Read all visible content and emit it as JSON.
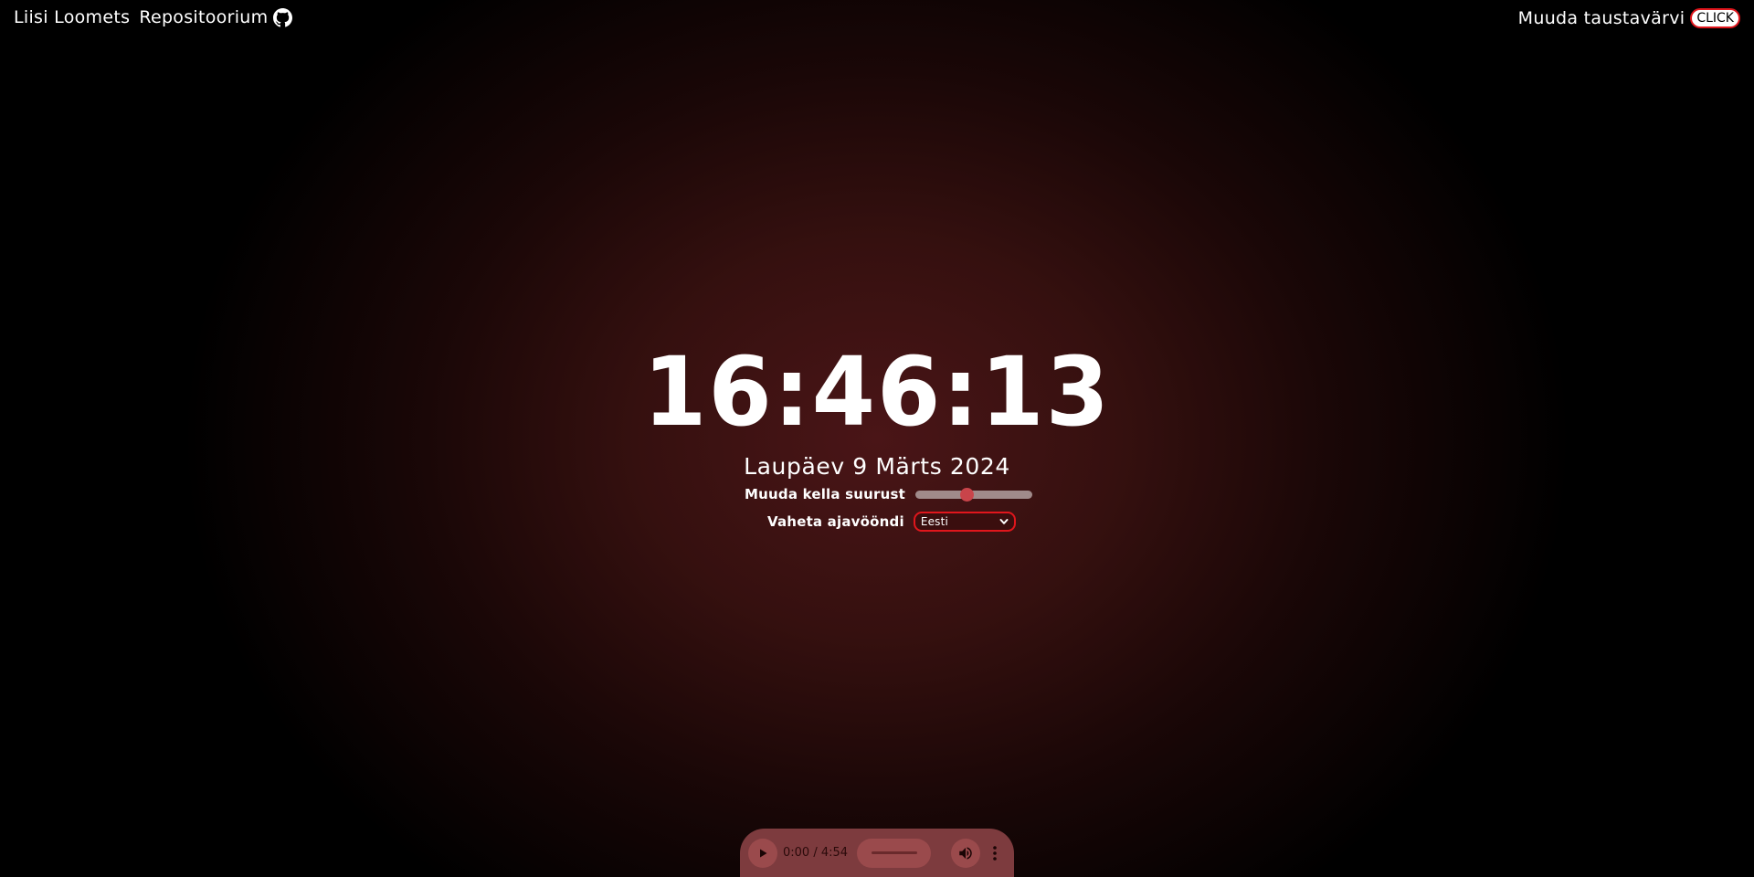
{
  "header": {
    "author": "Liisi Loomets",
    "repo_label": "Repositoorium",
    "repo_icon": "github-icon",
    "bg_label": "Muuda taustavärvi",
    "bg_button": "CLICK"
  },
  "clock": {
    "time": "16:46:13",
    "date": "Laupäev 9 Märts 2024"
  },
  "controls": {
    "size_label": "Muuda kella suurust",
    "size_level": 0.44,
    "zone_label": "Vaheta ajavööndi",
    "zone_selected": "Eesti"
  },
  "audio": {
    "time": "0:00 / 4:54",
    "progress": 0
  },
  "colors": {
    "accent": "#e0161c",
    "background_center": "#4a1517",
    "background_edge": "#000000",
    "player": "#7d3b3e"
  }
}
